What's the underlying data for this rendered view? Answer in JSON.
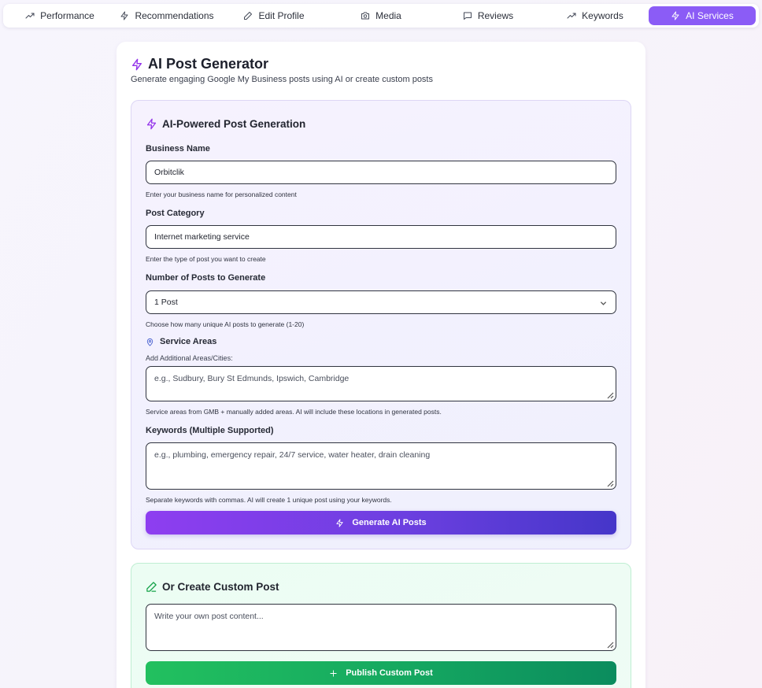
{
  "tabs": [
    {
      "label": "Performance",
      "icon": "trending-up-icon"
    },
    {
      "label": "Recommendations",
      "icon": "zap-icon"
    },
    {
      "label": "Edit Profile",
      "icon": "pencil-icon"
    },
    {
      "label": "Media",
      "icon": "camera-icon"
    },
    {
      "label": "Reviews",
      "icon": "message-square-icon"
    },
    {
      "label": "Keywords",
      "icon": "trending-up-icon"
    },
    {
      "label": "AI Services",
      "icon": "zap-icon",
      "active": true
    }
  ],
  "colors": {
    "accent": "#8b5cf6",
    "ai_icon": "#9333ea",
    "green": "#16a34a"
  },
  "card": {
    "title": "AI Post Generator",
    "subtitle": "Generate engaging Google My Business posts using AI or create custom posts"
  },
  "ai_panel": {
    "title": "AI-Powered Post Generation",
    "business_name": {
      "label": "Business Name",
      "value": "Orbitclik",
      "hint": "Enter your business name for personalized content"
    },
    "post_category": {
      "label": "Post Category",
      "value": "Internet marketing service",
      "hint": "Enter the type of post you want to create"
    },
    "num_posts": {
      "label": "Number of Posts to Generate",
      "value": "1 Post",
      "hint": "Choose how many unique AI posts to generate (1-20)"
    },
    "service_areas": {
      "label": "Service Areas",
      "sublabel": "Add Additional Areas/Cities:",
      "placeholder": "e.g., Sudbury, Bury St Edmunds, Ipswich, Cambridge",
      "hint": "Service areas from GMB + manually added areas. AI will include these locations in generated posts."
    },
    "keywords": {
      "label": "Keywords (Multiple Supported)",
      "placeholder": "e.g., plumbing, emergency repair, 24/7 service, water heater, drain cleaning",
      "hint": "Separate keywords with commas. AI will create 1 unique post using your keywords."
    },
    "generate_button": "Generate AI Posts"
  },
  "custom_panel": {
    "title": "Or Create Custom Post",
    "placeholder": "Write your own post content...",
    "publish_button": "Publish Custom Post"
  }
}
